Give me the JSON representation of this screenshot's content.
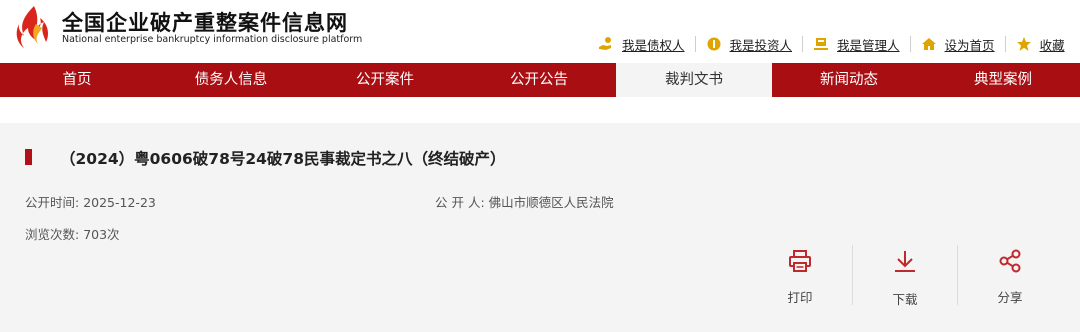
{
  "header": {
    "title": "全国企业破产重整案件信息网",
    "subtitle": "National enterprise bankruptcy  information disclosure platform",
    "links": [
      {
        "label": "我是债权人",
        "icon": "hand-coin-icon"
      },
      {
        "label": "我是投资人",
        "icon": "coin-icon"
      },
      {
        "label": "我是管理人",
        "icon": "manager-icon"
      },
      {
        "label": "设为首页",
        "icon": "home-icon"
      },
      {
        "label": "收藏",
        "icon": "star-icon"
      }
    ]
  },
  "nav": {
    "items": [
      "首页",
      "债务人信息",
      "公开案件",
      "公开公告",
      "裁判文书",
      "新闻动态",
      "典型案例"
    ],
    "active_index": 4
  },
  "document": {
    "title": "（2024）粤0606破78号24破78民事裁定书之八（终结破产）",
    "publish_time_label": "公开时间:",
    "publish_time": "2025-12-23",
    "publisher_label": "公 开 人:",
    "publisher": "佛山市顺德区人民法院",
    "views_label": "浏览次数:",
    "views": "703次"
  },
  "actions": [
    {
      "label": "打印",
      "icon": "printer-icon"
    },
    {
      "label": "下载",
      "icon": "download-icon"
    },
    {
      "label": "分享",
      "icon": "share-icon"
    }
  ],
  "colors": {
    "brand_red": "#a90f12",
    "content_bg": "#f4f4f4",
    "icon_red": "#c0282b",
    "icon_gold": "#e0a400"
  }
}
